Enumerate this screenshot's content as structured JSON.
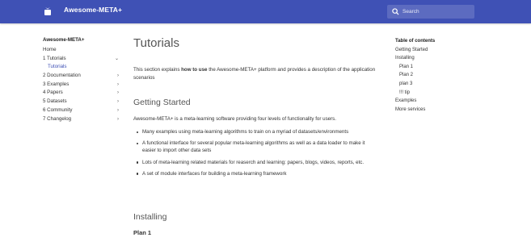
{
  "header": {
    "site_title": "Awesome-META+",
    "search_placeholder": "Search"
  },
  "nav": {
    "title": "Awesome-META+",
    "items": [
      {
        "label": "Home"
      },
      {
        "label": "1 Tutorials"
      },
      {
        "label": "Tutorials"
      },
      {
        "label": "2 Documentation"
      },
      {
        "label": "3 Examples"
      },
      {
        "label": "4 Papers"
      },
      {
        "label": "5 Datasets"
      },
      {
        "label": "6 Community"
      },
      {
        "label": "7 Changelog"
      }
    ]
  },
  "content": {
    "title": "Tutorials",
    "intro_pre": "This section explains ",
    "intro_bold": "how to use",
    "intro_post": " the Awesome-META+ platform and provides a description of the application scenarios",
    "section1_title": "Getting Started",
    "section1_text": "Awesome-META+ is a meta-learning software providing four levels of functionality for users.",
    "bullets": [
      "Many examples using meta-learning algorithms to train on a myriad of datasets/environments",
      "A functional interface for several popular meta-learning algorithms as well as a data loader to make it easier to import other data sets",
      "Lots of meta-learning related materials for reaserch and learning: papers, blogs, videos, reports, etc.",
      "A set of module interfaces for building a meta-learning framework"
    ],
    "section2_title": "Installing",
    "subsection_title": "Plan 1"
  },
  "toc": {
    "title": "Table of contents",
    "items": [
      {
        "label": "Getting Started"
      },
      {
        "label": "Installing"
      },
      {
        "label": "Plan 1"
      },
      {
        "label": "Plan 2"
      },
      {
        "label": "plan 3"
      },
      {
        "label": "!!! tip"
      },
      {
        "label": "Examples"
      },
      {
        "label": "More services"
      }
    ]
  },
  "colors": {
    "header": "#3f51b5",
    "search_bg": "#5c6bc0",
    "active_link": "#3f51b5"
  },
  "icons": {
    "logo": "mortarboard-icon",
    "search": "search-icon",
    "expand": "chevron-down-icon",
    "navigate": "chevron-right-icon"
  }
}
